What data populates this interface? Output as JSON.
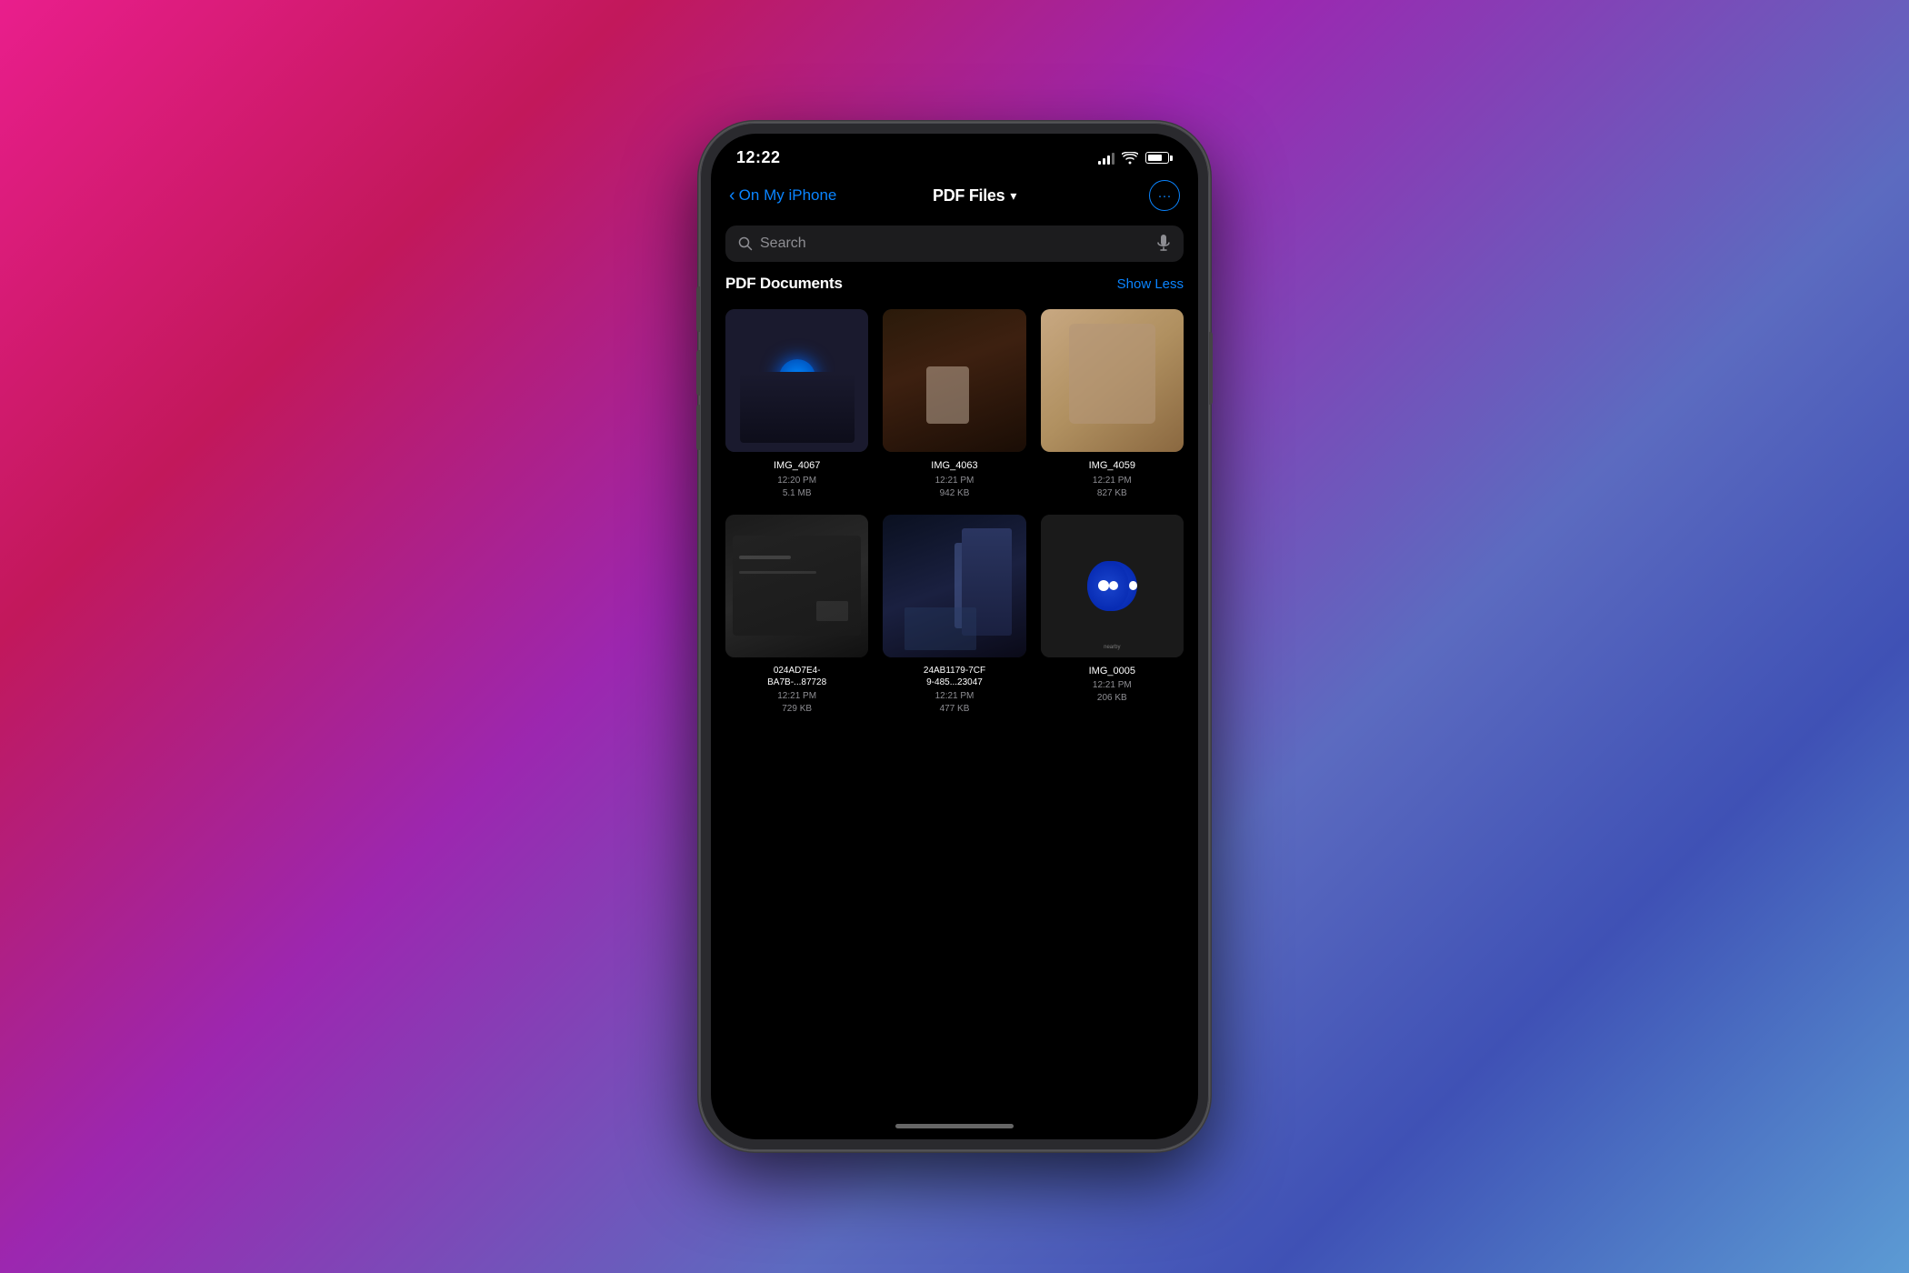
{
  "background": {
    "gradient": "linear-gradient(135deg, #e91e8c 0%, #c2185b 20%, #9c27b0 40%, #5c6bc0 65%, #3f51b5 80%, #5c9bd4 100%)"
  },
  "status_bar": {
    "time": "12:22",
    "signal_label": "signal",
    "wifi_label": "wifi",
    "battery_label": "battery"
  },
  "navigation": {
    "back_label": "On My iPhone",
    "title": "PDF Files",
    "title_chevron": "▾",
    "more_icon": "···"
  },
  "search": {
    "placeholder": "Search",
    "search_icon": "🔍",
    "mic_icon": "🎤"
  },
  "section": {
    "title": "PDF Documents",
    "show_less_label": "Show Less"
  },
  "files": [
    {
      "id": "img-4067",
      "name": "IMG_4067",
      "time": "12:20 PM",
      "size": "5.1 MB",
      "thumb_type": "thumb-img-4067"
    },
    {
      "id": "img-4063",
      "name": "IMG_4063",
      "time": "12:21 PM",
      "size": "942 KB",
      "thumb_type": "thumb-dark-1"
    },
    {
      "id": "img-4059",
      "name": "IMG_4059",
      "time": "12:21 PM",
      "size": "827 KB",
      "thumb_type": "thumb-hand"
    },
    {
      "id": "uuid-1",
      "name": "024AD7E4-\nBA7B-...87728",
      "time": "12:21 PM",
      "size": "729 KB",
      "thumb_type": "thumb-car"
    },
    {
      "id": "uuid-2",
      "name": "24AB1179-7CF\n9-485...23047",
      "time": "12:21 PM",
      "size": "477 KB",
      "thumb_type": "thumb-chair"
    },
    {
      "id": "img-0005",
      "name": "IMG_0005",
      "time": "12:21 PM",
      "size": "206 KB",
      "thumb_type": "thumb-airtag"
    }
  ]
}
